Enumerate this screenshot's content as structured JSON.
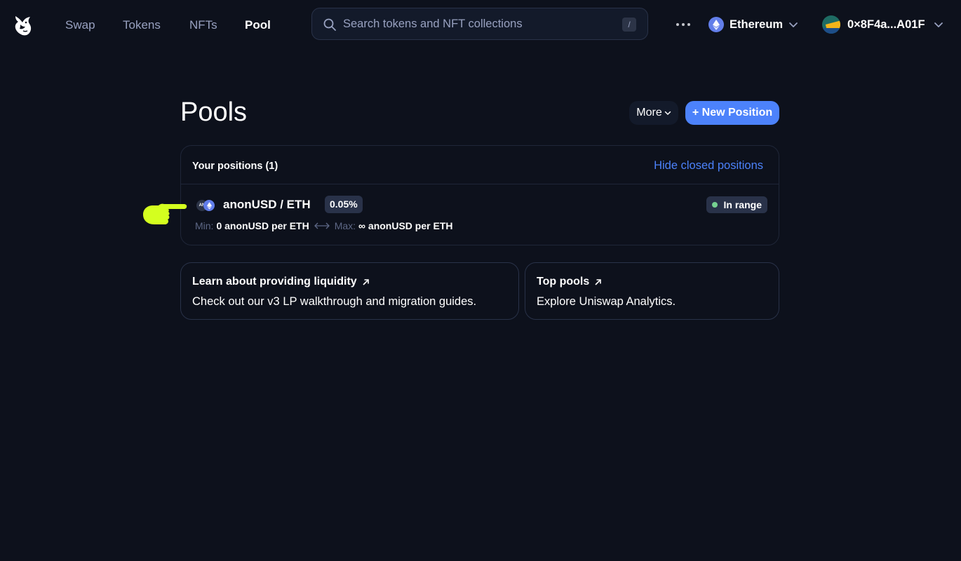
{
  "nav": {
    "logo": "uniswap-unicorn-logo",
    "links": [
      "Swap",
      "Tokens",
      "NFTs",
      "Pool"
    ],
    "active_link": "Pool",
    "search": {
      "placeholder": "Search tokens and NFT collections",
      "shortcut": "/"
    },
    "network": {
      "label": "Ethereum",
      "icon": "ethereum-icon"
    },
    "account": {
      "label": "0×8F4a...A01F"
    }
  },
  "page": {
    "title": "Pools",
    "more_label": "More",
    "new_position_label": "+ New Position"
  },
  "positions": {
    "title": "Your positions (1)",
    "hide_closed_label": "Hide closed positions",
    "items": [
      {
        "pair": "anonUSD / ETH",
        "token_a_abbrev": "AN",
        "fee": "0.05%",
        "status": "In range",
        "min_label": "Min:",
        "min_value": "0 anonUSD per ETH",
        "max_label": "Max:",
        "max_value": "∞ anonUSD per ETH"
      }
    ]
  },
  "cards": [
    {
      "title": "Learn about providing liquidity",
      "desc": "Check out our v3 LP walkthrough and migration guides."
    },
    {
      "title": "Top pools",
      "desc": "Explore Uniswap Analytics."
    }
  ],
  "colors": {
    "background": "#0d111c",
    "accent": "#4c82fb",
    "in_range": "#76d191",
    "pointer": "#d4ff1f"
  }
}
